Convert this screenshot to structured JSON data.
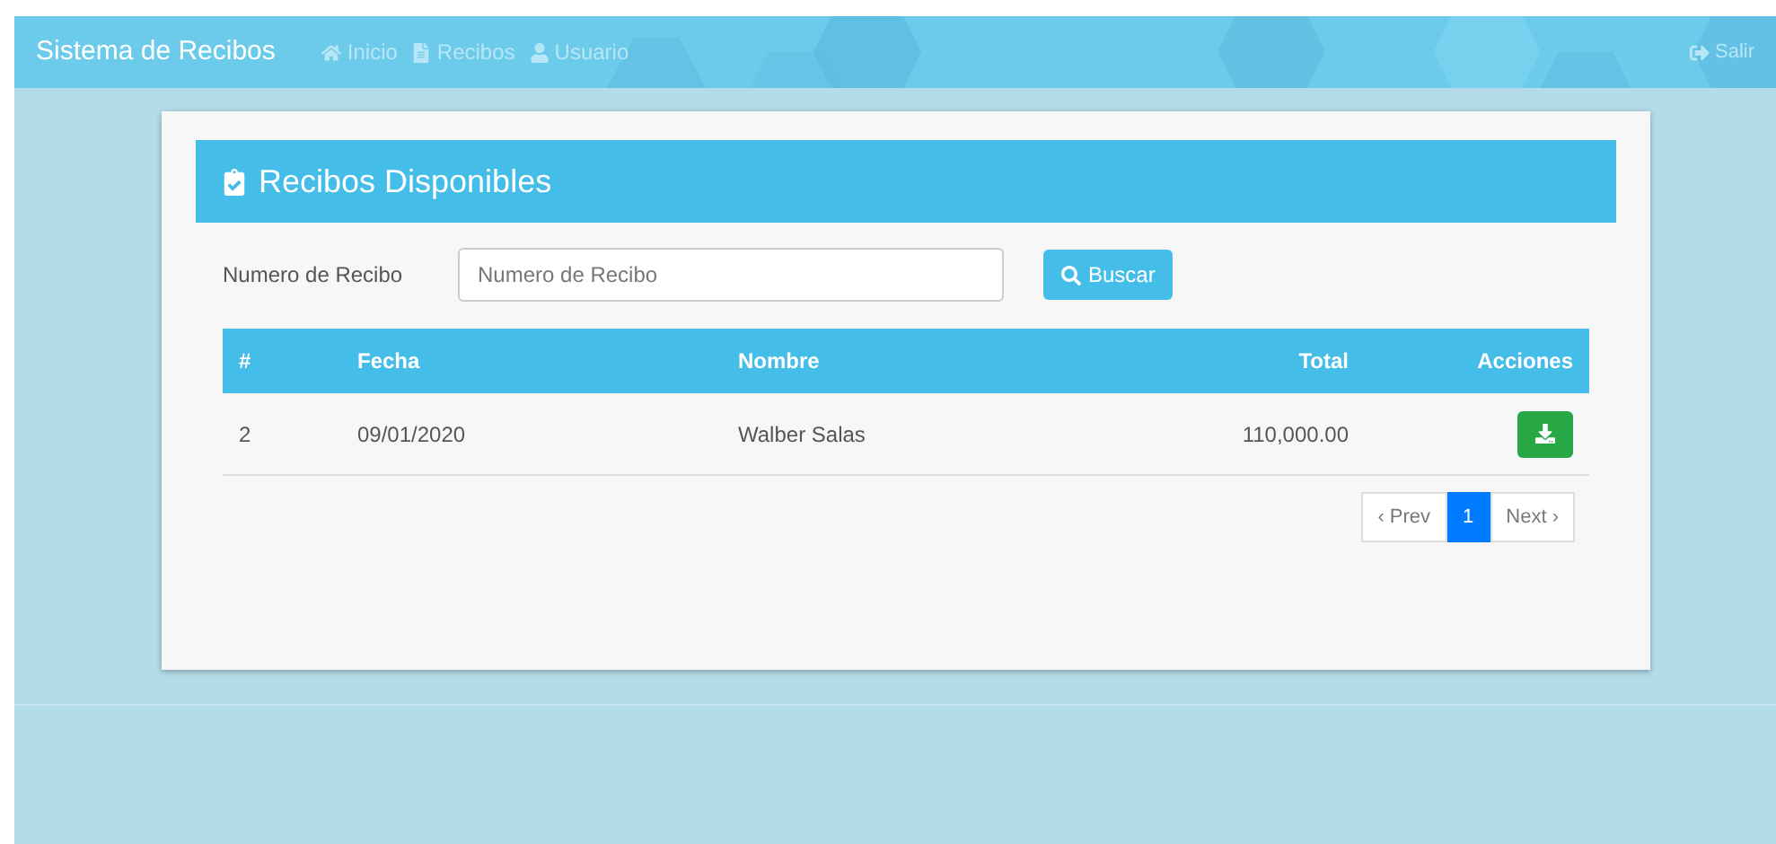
{
  "navbar": {
    "brand": "Sistema de Recibos",
    "links": [
      {
        "label": "Inicio"
      },
      {
        "label": "Recibos"
      },
      {
        "label": "Usuario"
      }
    ],
    "logout": {
      "label": "Salir"
    }
  },
  "panel": {
    "title": "Recibos Disponibles"
  },
  "search": {
    "label": "Numero de Recibo",
    "placeholder": "Numero de Recibo",
    "button": "Buscar"
  },
  "table": {
    "columns": [
      "#",
      "Fecha",
      "Nombre",
      "Total",
      "Acciones"
    ],
    "rows": [
      {
        "cells": [
          "2",
          "09/01/2020",
          "Walber Salas",
          "110,000.00"
        ]
      }
    ]
  },
  "pagination": [
    {
      "label": "‹ Prev",
      "selected": false
    },
    {
      "label": "1",
      "selected": true
    },
    {
      "label": "Next ›",
      "selected": false
    }
  ]
}
